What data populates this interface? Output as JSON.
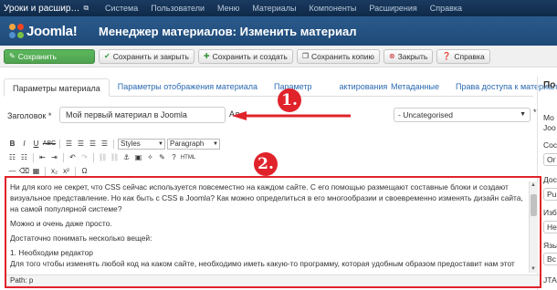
{
  "topbar": {
    "site_name": "Уроки и расшир…",
    "menu": [
      "Система",
      "Пользователи",
      "Меню",
      "Материалы",
      "Компоненты",
      "Расширения",
      "Справка"
    ]
  },
  "header": {
    "logo_text": "Joomla!",
    "title": "Менеджер материалов: Изменить материал"
  },
  "toolbar": {
    "save": "Сохранить",
    "save_close": "Сохранить и закрыть",
    "save_new": "Сохранить и создать",
    "save_copy": "Сохранить копию",
    "close": "Закрыть",
    "help": "Справка"
  },
  "tabs": [
    "Параметры материала",
    "Параметры отображения материала",
    "Параметры редактирования",
    "Метаданные",
    "Права доступа к материалу"
  ],
  "tab_partial": {
    "third_visible": "Параметр",
    "third_tail": "актирования"
  },
  "form": {
    "title_label": "Заголовок *",
    "title_value": "Мой первый материал в Joomla",
    "alias_label": "Ал",
    "category_value": "- Uncategorised",
    "category_star": "*"
  },
  "editor": {
    "styles": "Styles",
    "paragraph": "Paragraph",
    "html_btn": "HTML",
    "paragraphs": [
      "Ни для кого не секрет, что CSS сейчас используется повсеместно на каждом сайте. С его помощью размещают составные блоки и создают визуальное представление. Но как быть с CSS в Joomla? Как можно определиться в его многообразии и своевременно изменять дизайн сайта, на самой популярной системе?",
      "Можно и очень даже просто.",
      "Достаточно понимать несколько вещей:",
      "1. Необходим редактор",
      "Для того чтобы изменять любой код на каком сайте, необходимо иметь какую-то программу, которая удобным образом предоставит нам этот"
    ],
    "path": "Path: p"
  },
  "right_panel": {
    "heading": "По",
    "items": [
      "Мо",
      "Joo",
      "Сос",
      "Ог",
      "Дос",
      "Pu",
      "Изб",
      "Не",
      "Язы",
      "Вс",
      "ЈТА"
    ]
  },
  "annotations": {
    "one": "1.",
    "two": "2."
  },
  "colors": {
    "accent_red": "#e0232b",
    "header_blue": "#1f4a78",
    "save_green": "#51a351"
  }
}
